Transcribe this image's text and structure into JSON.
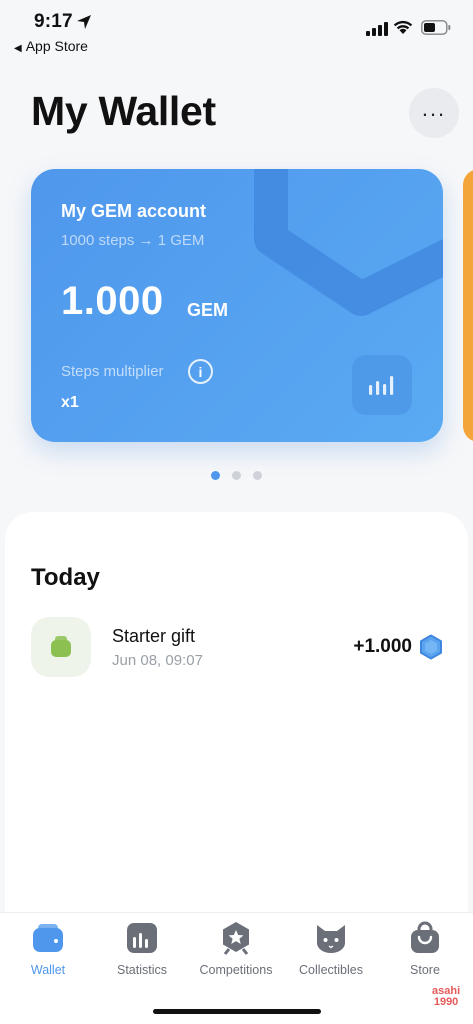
{
  "status_bar": {
    "time": "9:17",
    "back_app": "App Store"
  },
  "header": {
    "title": "My Wallet",
    "more_label": "..."
  },
  "card": {
    "title": "My GEM account",
    "rate": "1000 steps → 1 GEM",
    "amount": "1.000",
    "unit": "GEM",
    "multiplier_label": "Steps multiplier",
    "multiplier_value": "x1",
    "info_glyph": "i",
    "accent_color": "#4f97ec"
  },
  "pager": {
    "count": 3,
    "active_index": 0
  },
  "transactions": {
    "section_title": "Today",
    "items": [
      {
        "name": "Starter gift",
        "date": "Jun 08, 09:07",
        "amount": "+1.000",
        "icon": "wallet-icon",
        "currency_icon": "gem-icon"
      }
    ]
  },
  "tabbar": {
    "tabs": [
      {
        "label": "Wallet",
        "icon": "wallet-icon",
        "active": true
      },
      {
        "label": "Statistics",
        "icon": "bar-chart-icon",
        "active": false
      },
      {
        "label": "Competitions",
        "icon": "star-badge-icon",
        "active": false
      },
      {
        "label": "Collectibles",
        "icon": "cat-icon",
        "active": false
      },
      {
        "label": "Store",
        "icon": "shopping-bag-icon",
        "active": false
      }
    ]
  },
  "watermark": {
    "line1": "asahi",
    "line2": "1990"
  }
}
